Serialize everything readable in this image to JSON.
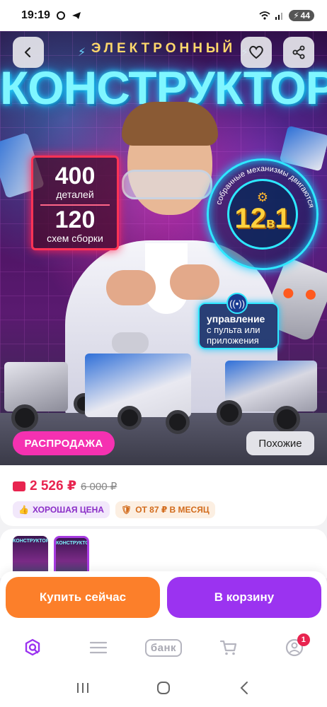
{
  "status_bar": {
    "time": "19:19",
    "battery": "44",
    "icons": [
      "chat-bubble-icon",
      "telegram-icon",
      "wifi-icon",
      "signal-icon",
      "battery-charging-icon"
    ]
  },
  "hero": {
    "subtitle": "ЭЛЕКТРОННЫЙ",
    "title": "КОНСТРУКТОР",
    "stats": [
      {
        "number": "400",
        "label": "деталей"
      },
      {
        "number": "120",
        "label": "схем сборки"
      }
    ],
    "circle": {
      "main": "12",
      "small": "в",
      "main2": "1",
      "ring_text": "собранные механизмы двигаются"
    },
    "control_badge": {
      "title": "управление",
      "line1": "с пульта или",
      "line2": "приложения"
    },
    "sale_label": "РАСПРОДАЖА",
    "similar_label": "Похожие",
    "buttons": [
      "back-icon",
      "heart-icon",
      "share-icon"
    ]
  },
  "price": {
    "current": "2 526 ₽",
    "old": "6 000 ₽",
    "chips": [
      {
        "label": "ХОРОШАЯ ЦЕНА",
        "icon": "thumbs-up-icon"
      },
      {
        "label": "ОТ 87 ₽ В МЕСЯЦ",
        "icon": "shield-icon"
      }
    ]
  },
  "thumbnails": {
    "items": [
      {
        "caption": "КОНСТРУКТОР",
        "selected": false
      },
      {
        "caption": "КОНСТРУКТОР",
        "selected": true
      }
    ]
  },
  "actions": {
    "buy": "Купить сейчас",
    "cart": "В корзину"
  },
  "bottom_nav": {
    "items": [
      {
        "name": "search",
        "icon": "search-icon",
        "active": true
      },
      {
        "name": "catalog",
        "icon": "menu-icon",
        "active": false
      },
      {
        "name": "bank",
        "label": "банк",
        "active": false
      },
      {
        "name": "cart",
        "icon": "cart-icon",
        "active": false
      },
      {
        "name": "profile",
        "icon": "profile-icon",
        "badge": "1",
        "active": false
      }
    ]
  },
  "colors": {
    "accent_orange": "#fc7f2a",
    "accent_purple": "#9b33f0",
    "price_red": "#e8244f",
    "sale_pink": "#f531b1"
  }
}
